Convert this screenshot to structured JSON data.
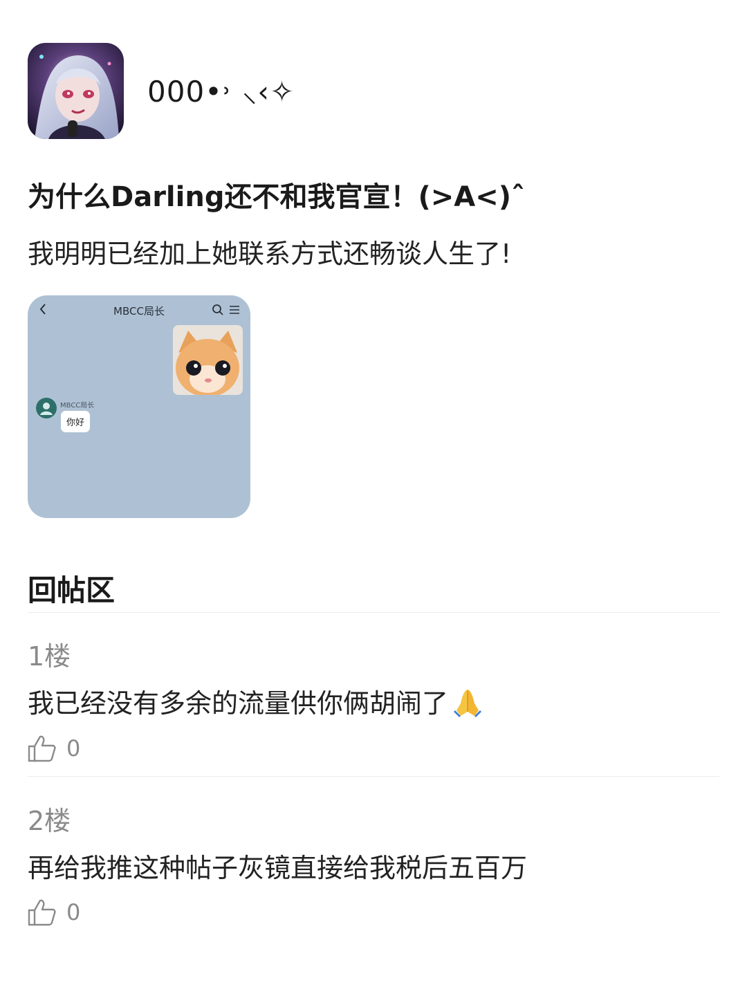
{
  "author": {
    "name": "000•˒ ⸜‹✧",
    "avatar_icon": "anime-avatar"
  },
  "post": {
    "title": "为什么Darling还不和我官宣！(>A<)ˆ",
    "body": "我明明已经加上她联系方式还畅谈人生了!",
    "attachment": {
      "chat_title": "MBCC局长",
      "sender_name": "MBCC局长",
      "message": "你好"
    }
  },
  "replies_section": {
    "heading": "回帖区",
    "replies": [
      {
        "floor": "1楼",
        "text": "我已经没有多余的流量供你俩胡闹了",
        "emoji_icon": "folded-hands-icon",
        "likes": "0"
      },
      {
        "floor": "2楼",
        "text": "再给我推这种帖子灰镜直接给我税后五百万",
        "likes": "0"
      }
    ]
  }
}
